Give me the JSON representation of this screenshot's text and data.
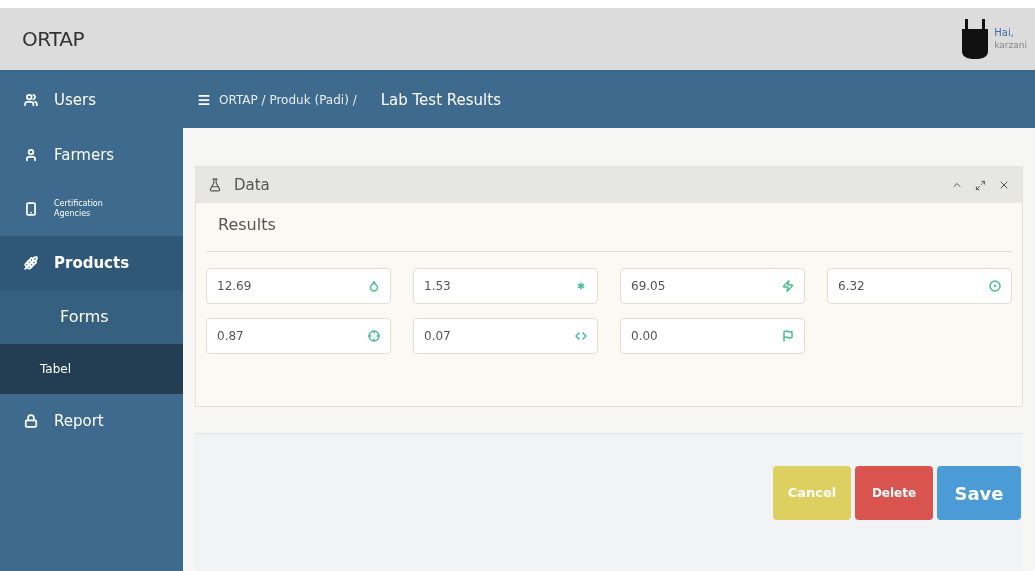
{
  "top_bar": {
    "brand": "ORTAP",
    "user": {
      "greeting": "Hai,",
      "name": "karzani"
    }
  },
  "sidebar": {
    "items": [
      {
        "label": "Users",
        "selected": false,
        "kind": "large"
      },
      {
        "label": "Farmers",
        "selected": false,
        "kind": "large"
      },
      {
        "label": "Certification Agencies",
        "selected": false,
        "kind": "small"
      },
      {
        "label": "Products",
        "selected": true,
        "kind": "large",
        "children": [
          {
            "label": "Forms",
            "selected": false
          },
          {
            "label": "Tabel",
            "selected": true
          }
        ]
      },
      {
        "label": "Report",
        "selected": false,
        "kind": "large"
      }
    ]
  },
  "breadcrumb": {
    "path": "ORTAP / Produk (Padi) /",
    "current": "Lab Test Results"
  },
  "panel": {
    "title": "Data",
    "section": "Results",
    "fields": [
      {
        "value": "12.69"
      },
      {
        "value": "1.53"
      },
      {
        "value": "69.05"
      },
      {
        "value": "6.32"
      },
      {
        "value": "0.87"
      },
      {
        "value": "0.07"
      },
      {
        "value": "0.00"
      }
    ]
  },
  "buttons": [
    {
      "label": "Cancel",
      "kind": "cancel"
    },
    {
      "label": "Delete",
      "kind": "delete"
    },
    {
      "label": "Save",
      "kind": "save"
    }
  ]
}
